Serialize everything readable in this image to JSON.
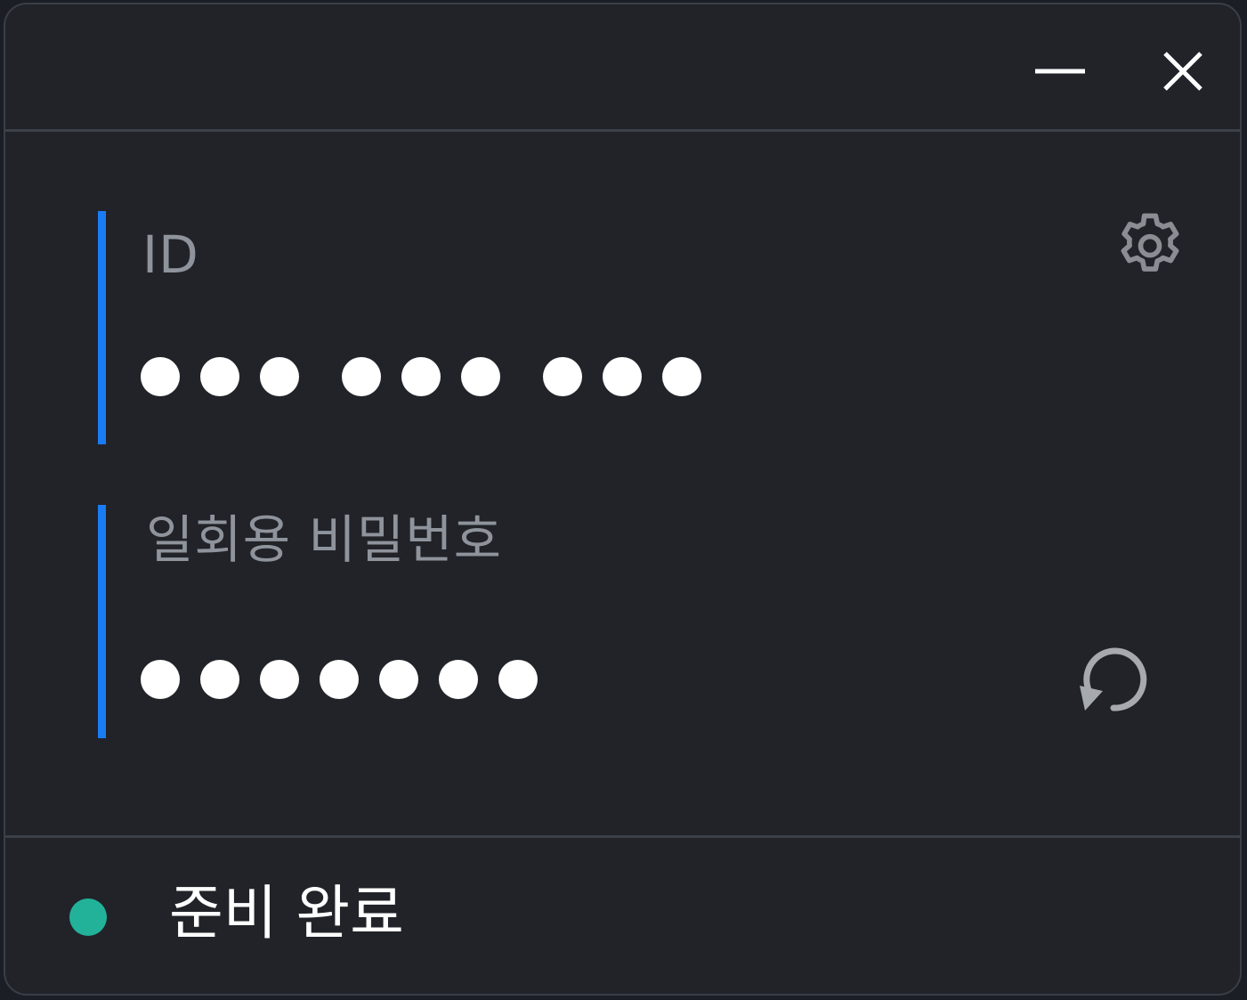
{
  "window": {
    "controls": {
      "minimize_icon": "minimize-icon",
      "close_icon": "close-icon"
    }
  },
  "id_field": {
    "label": "ID",
    "masked_groups": [
      3,
      3,
      3
    ]
  },
  "otp_field": {
    "label": "일회용 비밀번호",
    "masked_count": 7
  },
  "icons": {
    "settings": "gear-icon",
    "refresh": "refresh-icon"
  },
  "status": {
    "text": "준비 완료",
    "color": "#22b29a"
  },
  "colors": {
    "accent": "#1a7cf4",
    "background": "#212329",
    "label": "#8f939b",
    "divider": "#3c4049"
  }
}
